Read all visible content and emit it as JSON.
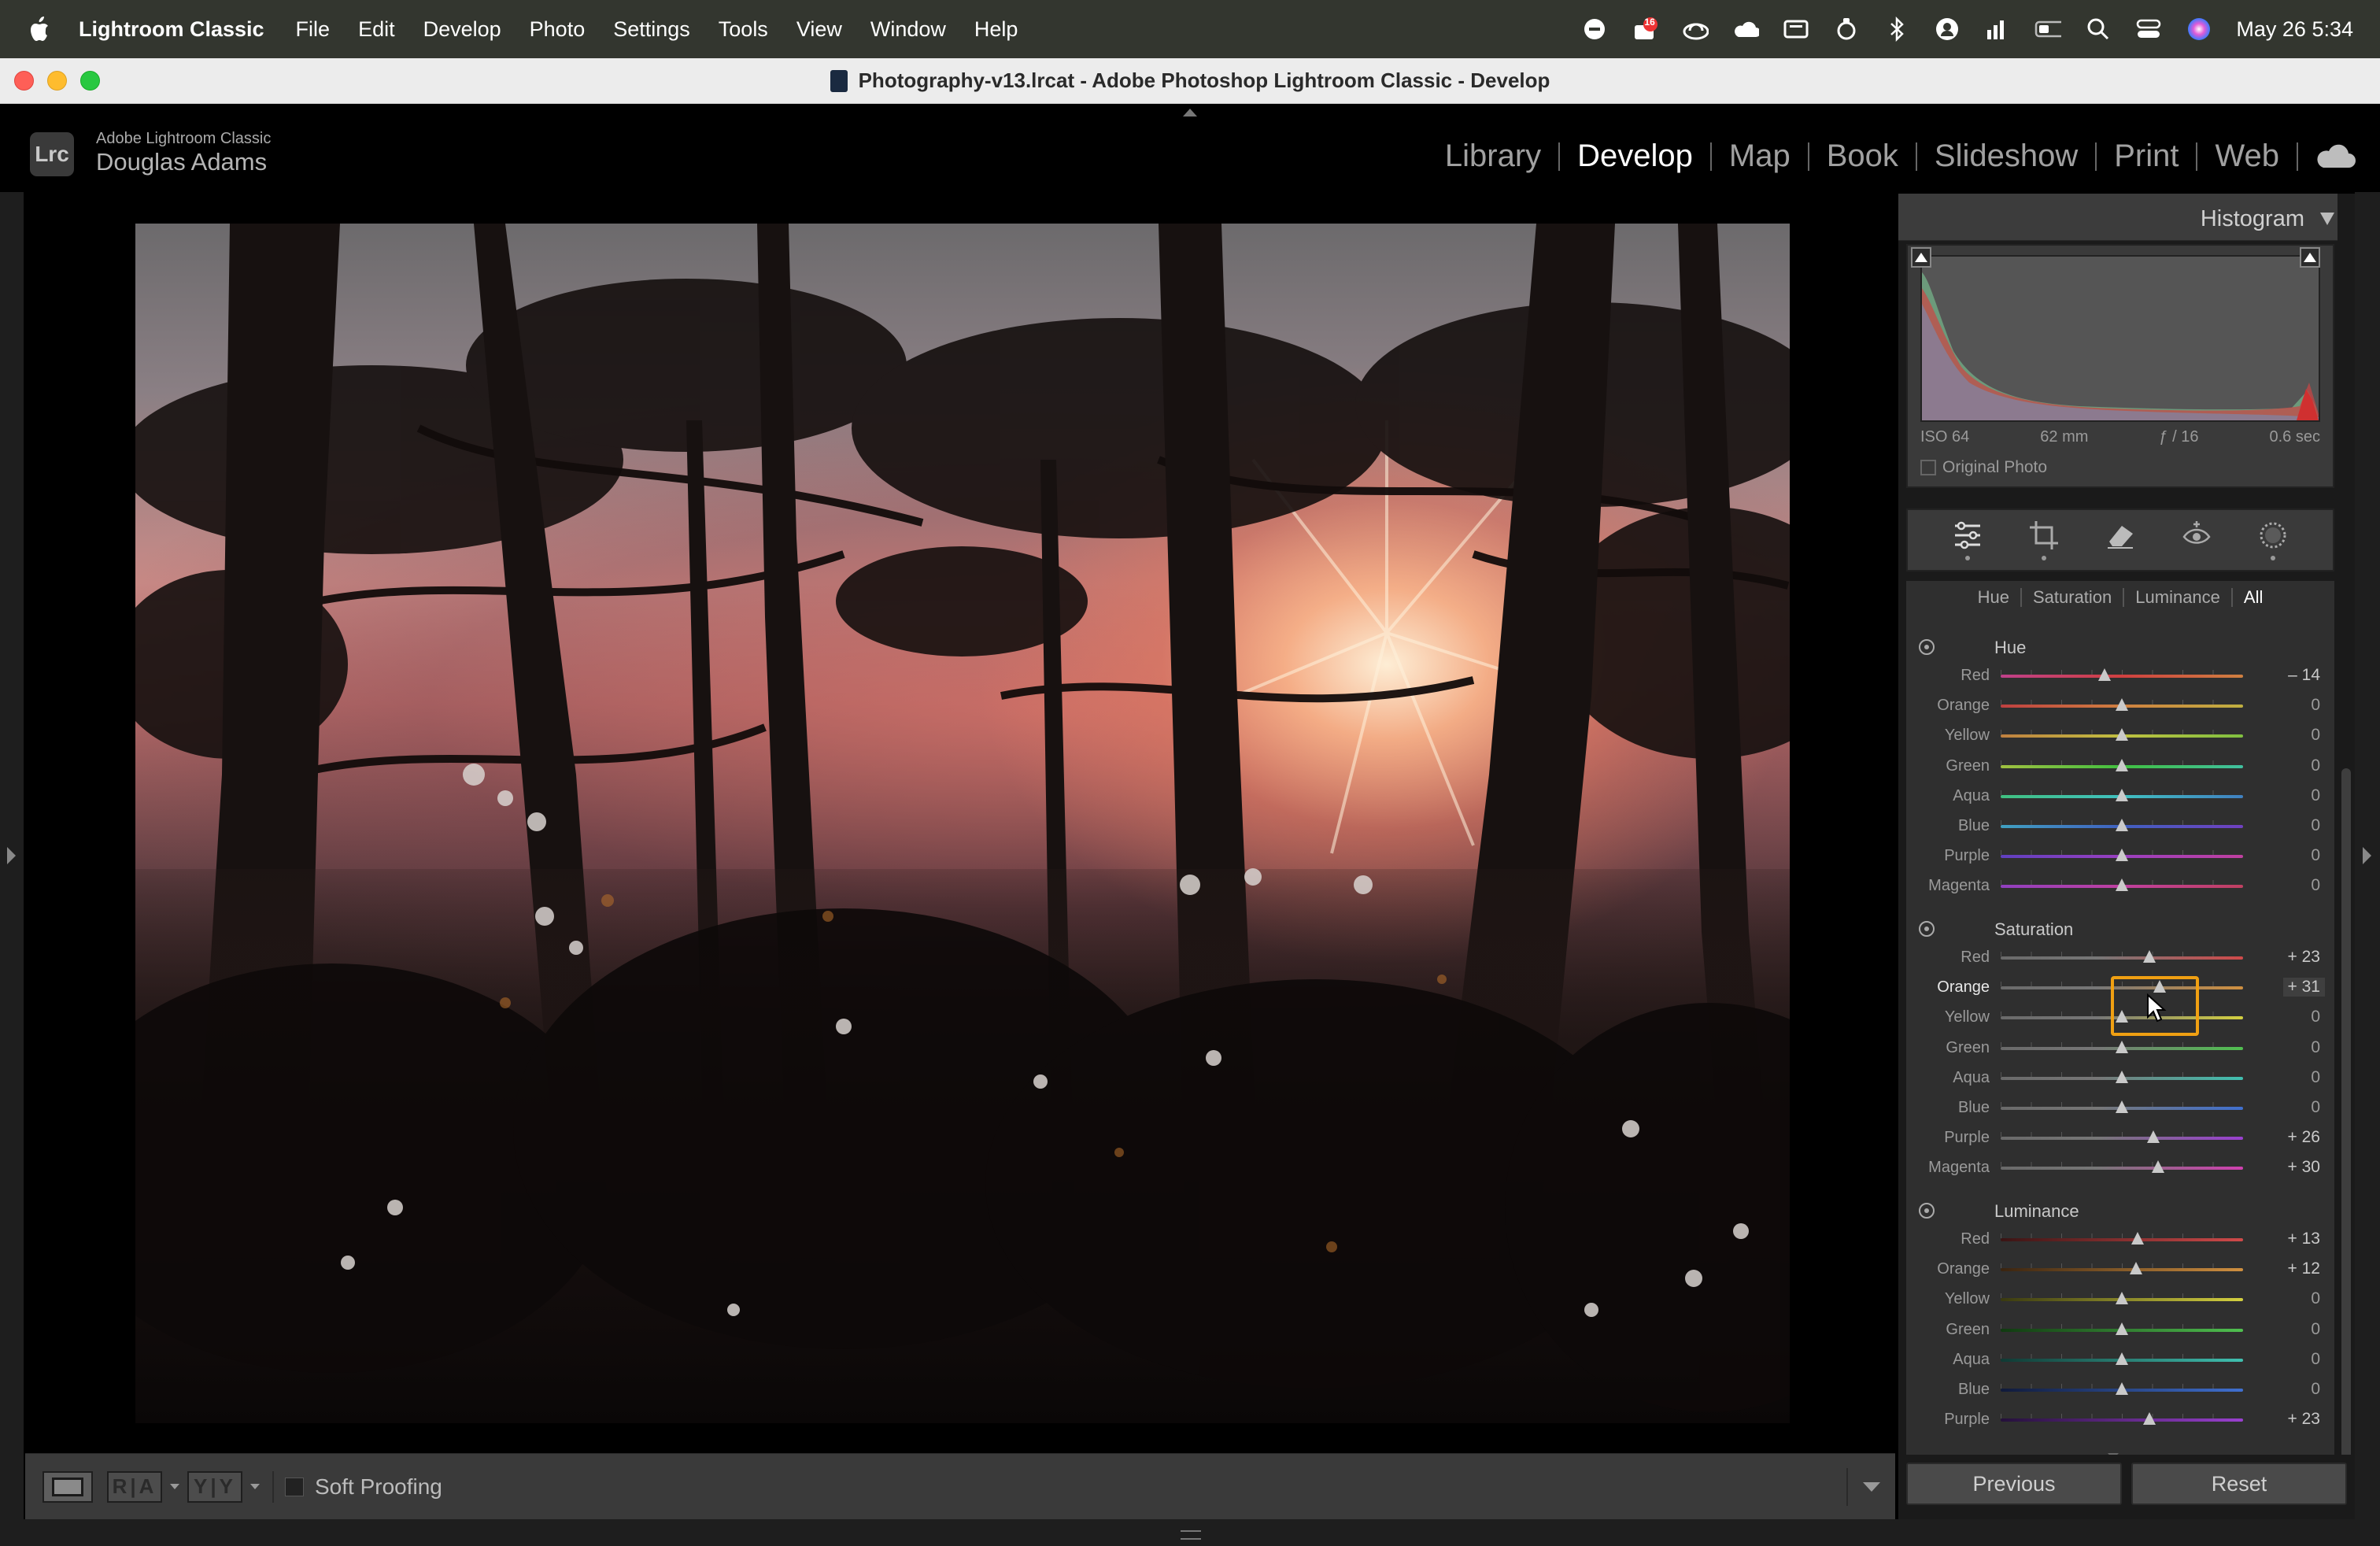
{
  "menubar": {
    "app_name": "Lightroom Classic",
    "items": [
      "File",
      "Edit",
      "Develop",
      "Photo",
      "Settings",
      "Tools",
      "View",
      "Window",
      "Help"
    ],
    "status_icons": [
      "minus-circle-icon",
      "badge-icon",
      "cloud-sync-icon",
      "cloud-icon",
      "display-icon",
      "ring-icon",
      "bluetooth-icon",
      "user-icon",
      "signal-icon",
      "battery-icon",
      "search-icon",
      "control-center-icon",
      "siri-icon"
    ],
    "badge_count": "16",
    "clock": "May 26  5:34"
  },
  "window": {
    "title": "Photography-v13.lrcat - Adobe Photoshop Lightroom Classic - Develop"
  },
  "identity": {
    "badge": "Lrc",
    "product": "Adobe Lightroom Classic",
    "user": "Douglas Adams"
  },
  "modules": {
    "items": [
      "Library",
      "Develop",
      "Map",
      "Book",
      "Slideshow",
      "Print",
      "Web"
    ],
    "active": "Develop"
  },
  "toolbar": {
    "ra_label": "R|A",
    "yy_label": "Y|Y",
    "soft_proofing": "Soft Proofing"
  },
  "histogram": {
    "title": "Histogram",
    "iso": "ISO 64",
    "focal": "62 mm",
    "aperture": "ƒ / 16",
    "shutter": "0.6 sec",
    "original_photo": "Original Photo"
  },
  "tools": [
    "sliders-icon",
    "crop-icon",
    "eraser-icon",
    "redeye-icon",
    "mask-icon"
  ],
  "hsl": {
    "tabs": [
      "Hue",
      "Saturation",
      "Luminance",
      "All"
    ],
    "active_tab": "All",
    "groups": [
      {
        "title": "Hue",
        "rows": [
          {
            "label": "Red",
            "value": "– 14",
            "num": -14
          },
          {
            "label": "Orange",
            "value": "0",
            "num": 0
          },
          {
            "label": "Yellow",
            "value": "0",
            "num": 0
          },
          {
            "label": "Green",
            "value": "0",
            "num": 0
          },
          {
            "label": "Aqua",
            "value": "0",
            "num": 0
          },
          {
            "label": "Blue",
            "value": "0",
            "num": 0
          },
          {
            "label": "Purple",
            "value": "0",
            "num": 0
          },
          {
            "label": "Magenta",
            "value": "0",
            "num": 0
          }
        ]
      },
      {
        "title": "Saturation",
        "rows": [
          {
            "label": "Red",
            "value": "+ 23",
            "num": 23
          },
          {
            "label": "Orange",
            "value": "+ 31",
            "num": 31
          },
          {
            "label": "Yellow",
            "value": "0",
            "num": 0
          },
          {
            "label": "Green",
            "value": "0",
            "num": 0
          },
          {
            "label": "Aqua",
            "value": "0",
            "num": 0
          },
          {
            "label": "Blue",
            "value": "0",
            "num": 0
          },
          {
            "label": "Purple",
            "value": "+ 26",
            "num": 26
          },
          {
            "label": "Magenta",
            "value": "+ 30",
            "num": 30
          }
        ]
      },
      {
        "title": "Luminance",
        "rows": [
          {
            "label": "Red",
            "value": "+ 13",
            "num": 13
          },
          {
            "label": "Orange",
            "value": "+ 12",
            "num": 12
          },
          {
            "label": "Yellow",
            "value": "0",
            "num": 0
          },
          {
            "label": "Green",
            "value": "0",
            "num": 0
          },
          {
            "label": "Aqua",
            "value": "0",
            "num": 0
          },
          {
            "label": "Blue",
            "value": "0",
            "num": 0
          },
          {
            "label": "Purple",
            "value": "+ 23",
            "num": 23
          }
        ]
      }
    ],
    "slider_range": [
      -100,
      100
    ],
    "active_slider": "Saturation Orange"
  },
  "footer": {
    "previous": "Previous",
    "reset": "Reset"
  },
  "colors": {
    "highlight": "#f0a012",
    "panel_bg": "#2f2f2f",
    "menubar_bg": "#33362f"
  }
}
